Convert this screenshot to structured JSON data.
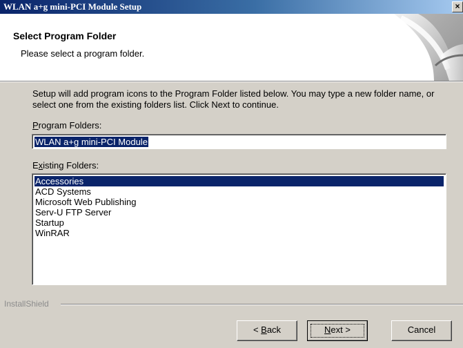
{
  "window": {
    "title": "WLAN a+g mini-PCI Module Setup",
    "close_glyph": "×"
  },
  "header": {
    "title": "Select Program Folder",
    "subtitle": "Please select a program folder."
  },
  "description": "Setup will add program icons to the Program Folder listed below.  You may type a new folder name, or select one from the existing folders list.  Click Next to continue.",
  "program_folders": {
    "label_prefix": "",
    "label_mnemonic": "P",
    "label_rest": "rogram Folders:",
    "value": "WLAN a+g mini-PCI Module"
  },
  "existing_folders": {
    "label_prefix": "E",
    "label_mnemonic": "x",
    "label_rest": "isting Folders:",
    "items": [
      {
        "label": "Accessories",
        "selected": true
      },
      {
        "label": "ACD Systems",
        "selected": false
      },
      {
        "label": "Microsoft Web Publishing",
        "selected": false
      },
      {
        "label": "Serv-U FTP Server",
        "selected": false
      },
      {
        "label": "Startup",
        "selected": false
      },
      {
        "label": "WinRAR",
        "selected": false
      }
    ]
  },
  "footer": {
    "brand": "InstallShield"
  },
  "buttons": {
    "back_prefix": "< ",
    "back_mnemonic": "B",
    "back_rest": "ack",
    "next_mnemonic": "N",
    "next_rest": "ext >",
    "cancel": "Cancel"
  },
  "colors": {
    "selection": "#0a246a",
    "dialog_face": "#d4d0c8",
    "title_gradient_start": "#0a246a",
    "title_gradient_end": "#a6caf0"
  }
}
